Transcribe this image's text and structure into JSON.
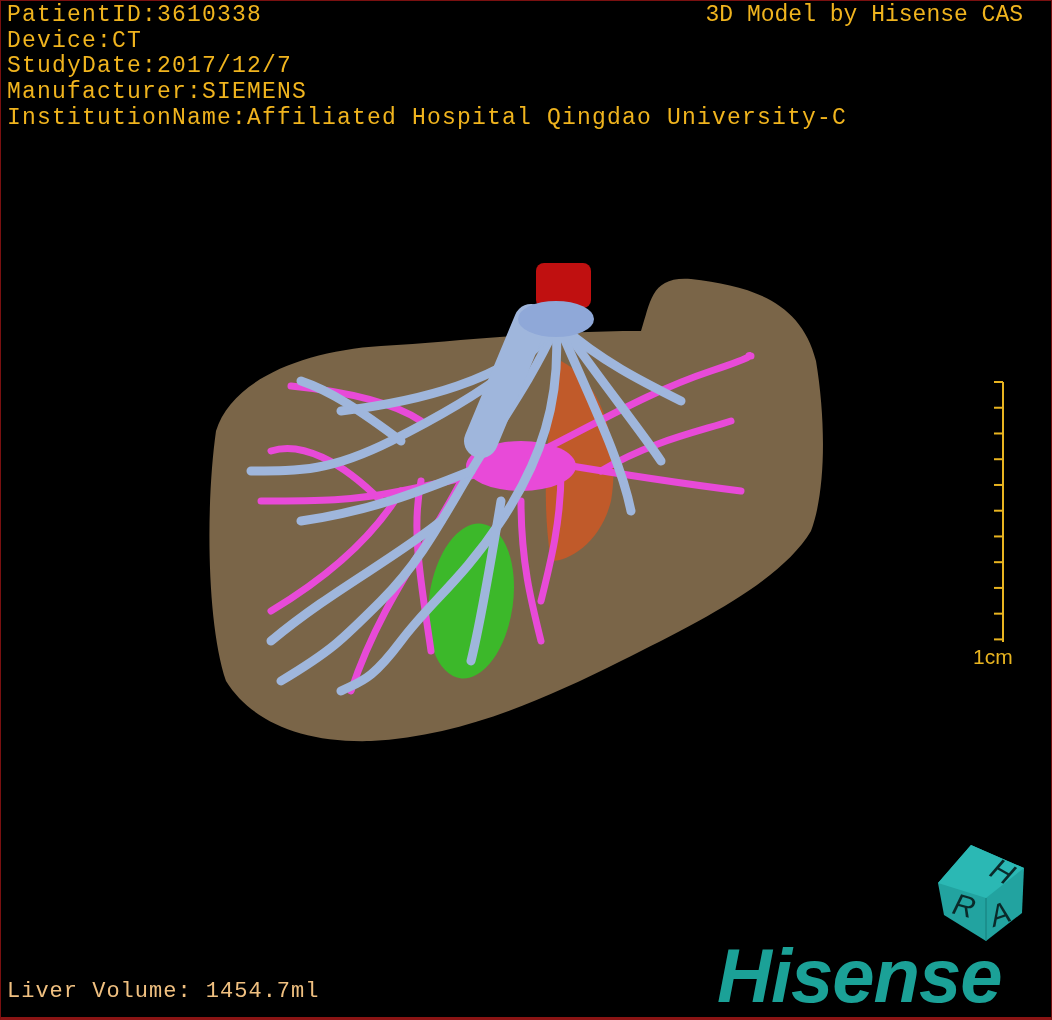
{
  "info_lines": [
    "PatientID:3610338",
    "Device:CT",
    "StudyDate:2017/12/7",
    "Manufacturer:SIEMENS",
    "InstitutionName:Affiliated Hospital Qingdao University-C"
  ],
  "model_credit": "3D Model by Hisense CAS",
  "scale_bar": {
    "label": "1cm"
  },
  "orientation_cube": {
    "labels": [
      "H",
      "R",
      "A"
    ]
  },
  "logo": "Hisense",
  "liver_volume": "Liver Volume: 1454.7ml"
}
